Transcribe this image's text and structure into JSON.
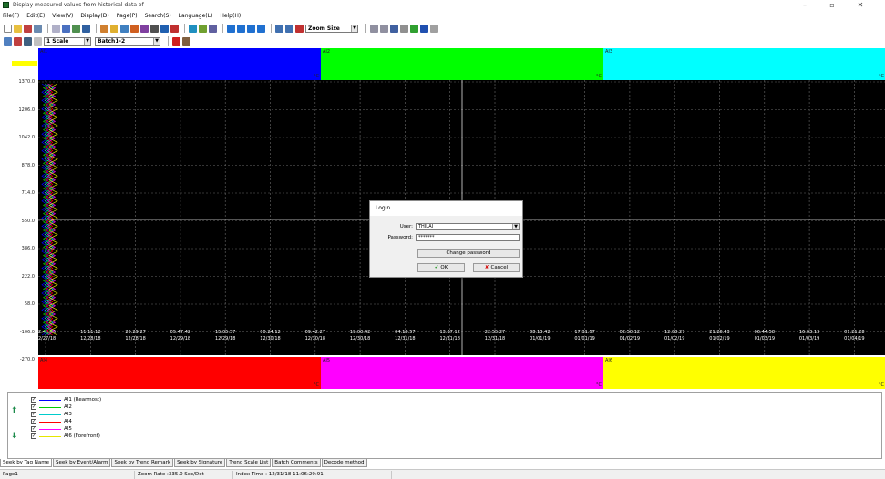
{
  "window": {
    "title": "Display measured values from historical data of",
    "minimize": "–",
    "maximize": "▫",
    "close": "✕"
  },
  "menu": [
    "File(F)",
    "Edit(E)",
    "View(V)",
    "Display(D)",
    "Page(P)",
    "Search(S)",
    "Language(L)",
    "Help(H)"
  ],
  "toolbar": {
    "zoom_combo": "Zoom Size",
    "scale_combo": "1 Scale",
    "batch_combo": "Batch1-2"
  },
  "channels_top": [
    {
      "name": "AI1",
      "unit": "°C",
      "color": "#0000ff"
    },
    {
      "name": "AI2",
      "unit": "°C",
      "color": "#00ff00"
    },
    {
      "name": "AI3",
      "unit": "°C",
      "color": "#00ffff"
    }
  ],
  "channels_bottom": [
    {
      "name": "AI4",
      "unit": "°C",
      "color": "#ff0000"
    },
    {
      "name": "AI5",
      "unit": "°C",
      "color": "#ff00ff"
    },
    {
      "name": "AI6",
      "unit": "°C",
      "color": "#ffff00"
    }
  ],
  "y_ticks": [
    "1370.0",
    "1206.0",
    "1042.0",
    "878.0",
    "714.0",
    "550.0",
    "386.0",
    "222.0",
    "58.0",
    "-106.0",
    "-270.0"
  ],
  "x_ticks": [
    {
      "time": "02:45:55",
      "date": "12/27/18"
    },
    {
      "time": "11:11:12",
      "date": "12/28/18"
    },
    {
      "time": "20:29:27",
      "date": "12/28/18"
    },
    {
      "time": "05:47:42",
      "date": "12/29/18"
    },
    {
      "time": "15:05:57",
      "date": "12/29/18"
    },
    {
      "time": "00:24:12",
      "date": "12/30/18"
    },
    {
      "time": "09:42:27",
      "date": "12/30/18"
    },
    {
      "time": "19:00:42",
      "date": "12/30/18"
    },
    {
      "time": "04:18:57",
      "date": "12/31/18"
    },
    {
      "time": "13:37:12",
      "date": "12/31/18"
    },
    {
      "time": "22:55:27",
      "date": "12/31/18"
    },
    {
      "time": "08:13:42",
      "date": "01/01/19"
    },
    {
      "time": "17:31:57",
      "date": "01/01/19"
    },
    {
      "time": "02:50:12",
      "date": "01/02/19"
    },
    {
      "time": "12:08:27",
      "date": "01/02/19"
    },
    {
      "time": "21:26:43",
      "date": "01/02/19"
    },
    {
      "time": "06:44:58",
      "date": "01/03/19"
    },
    {
      "time": "16:03:13",
      "date": "01/03/19"
    },
    {
      "time": "01:21:28",
      "date": "01/04/19"
    }
  ],
  "legend": [
    {
      "label": "AI1  (Rearmost)",
      "color": "#0000ff",
      "checked": "✓"
    },
    {
      "label": "AI2",
      "color": "#00cc00",
      "checked": "✓"
    },
    {
      "label": "AI3",
      "color": "#00cccc",
      "checked": "✓"
    },
    {
      "label": "AI4",
      "color": "#ff0000",
      "checked": "✓"
    },
    {
      "label": "AI5",
      "color": "#ff00ff",
      "checked": "✓"
    },
    {
      "label": "AI6  (Forefront)",
      "color": "#e6e600",
      "checked": "✓"
    }
  ],
  "tabs": [
    "Seek by Tag Name",
    "Seek by Event/Alarm",
    "Seek by Trend Remark",
    "Seek by Signature",
    "Trend Scale List",
    "Batch Comments",
    "Decode method"
  ],
  "status": {
    "page": "Page1",
    "zoom_rate": "Zoom Rate :335.0 Sec/Dot",
    "index_time": "Index Time : 12/31/18 11:06:29:91"
  },
  "login": {
    "title": "Login",
    "user_label": "User:",
    "user_value": "THILAI",
    "password_label": "Password:",
    "password_value": "*******",
    "change_password": "Change password",
    "ok": "OK",
    "cancel": "Cancel"
  }
}
